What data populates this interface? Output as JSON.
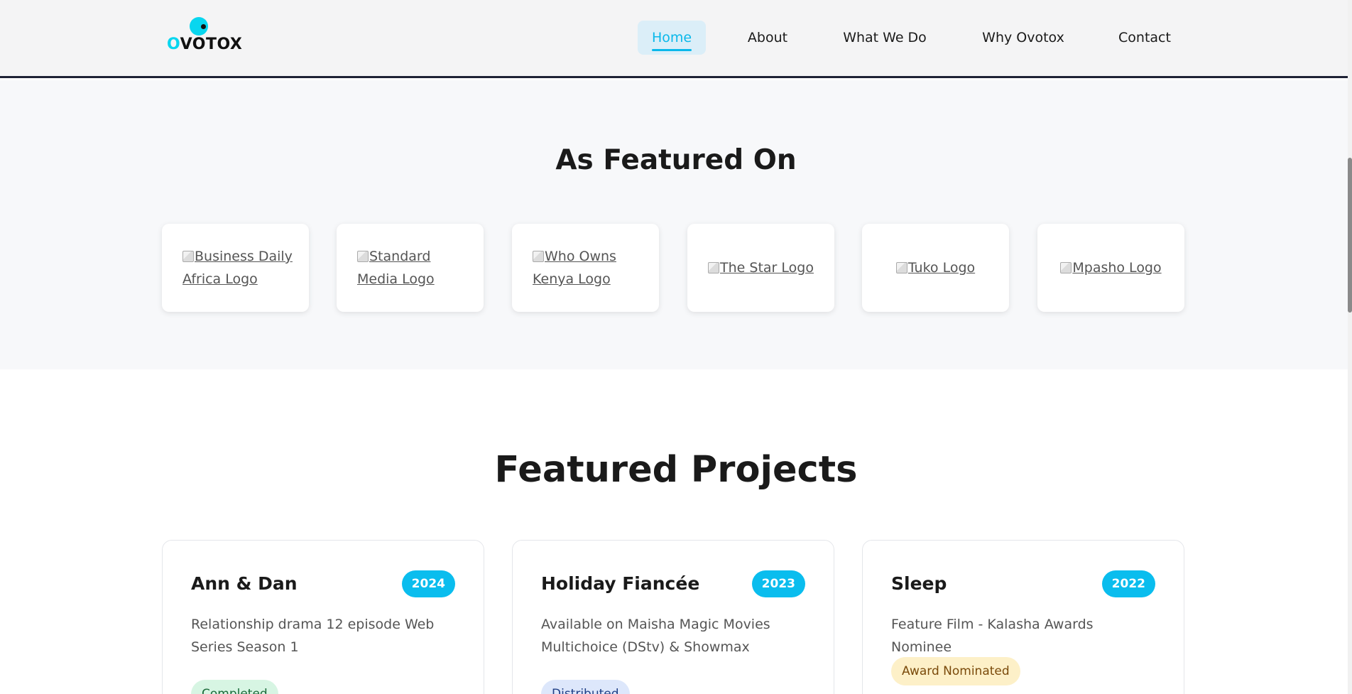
{
  "header": {
    "logo_text_first": "O",
    "logo_text_rest": "VOTOX",
    "nav": [
      {
        "label": "Home",
        "active": true
      },
      {
        "label": "About"
      },
      {
        "label": "What We Do"
      },
      {
        "label": "Why Ovotox"
      },
      {
        "label": "Contact"
      }
    ]
  },
  "featured_on": {
    "title": "As Featured On",
    "logos": [
      {
        "alt": "Business Daily Africa Logo"
      },
      {
        "alt": "Standard Media Logo"
      },
      {
        "alt": "Who Owns Kenya Logo"
      },
      {
        "alt": "The Star Logo"
      },
      {
        "alt": "Tuko Logo"
      },
      {
        "alt": "Mpasho Logo"
      }
    ]
  },
  "featured_projects": {
    "title": "Featured Projects",
    "projects": [
      {
        "name": "Ann & Dan",
        "year": "2024",
        "description": "Relationship drama 12 episode Web Series Season 1",
        "status": "Completed",
        "status_bg": "#d7f5e3",
        "status_color": "#1b6b3a"
      },
      {
        "name": "Holiday Fiancée",
        "year": "2023",
        "description": "Available on Maisha Magic Movies Multichoice (DStv) & Showmax",
        "status": "Distributed",
        "status_bg": "#dde7fb",
        "status_color": "#1f3f86"
      },
      {
        "name": "Sleep",
        "year": "2022",
        "description": "Feature Film - Kalasha Awards Nominee",
        "status": "Award Nominated",
        "status_bg": "#fdf0c8",
        "status_color": "#7a4a0b"
      }
    ]
  },
  "colors": {
    "accent": "#0abdee",
    "header_bg": "#f4f4f5",
    "section_bg": "#f7f8fa"
  }
}
